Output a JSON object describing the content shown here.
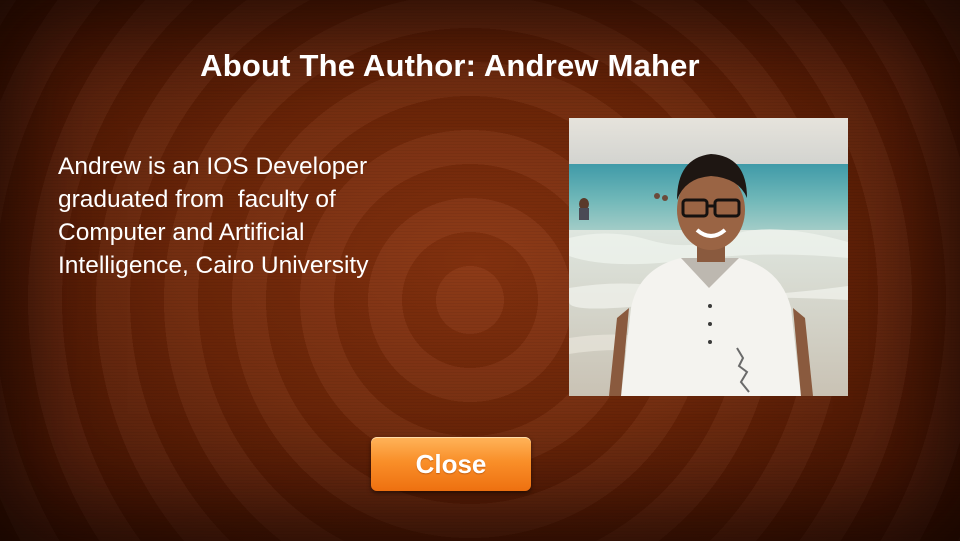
{
  "dialog": {
    "title": "About The Author: Andrew Maher",
    "bio": "Andrew is an IOS Developer\ngraduated from  faculty of\nComputer and Artificial\nIntelligence, Cairo University",
    "photo": {
      "icon": "author-photo"
    },
    "close_label": "Close"
  },
  "colors": {
    "background": "#6e2608",
    "text": "#ffffff",
    "button": "#f98f29"
  }
}
